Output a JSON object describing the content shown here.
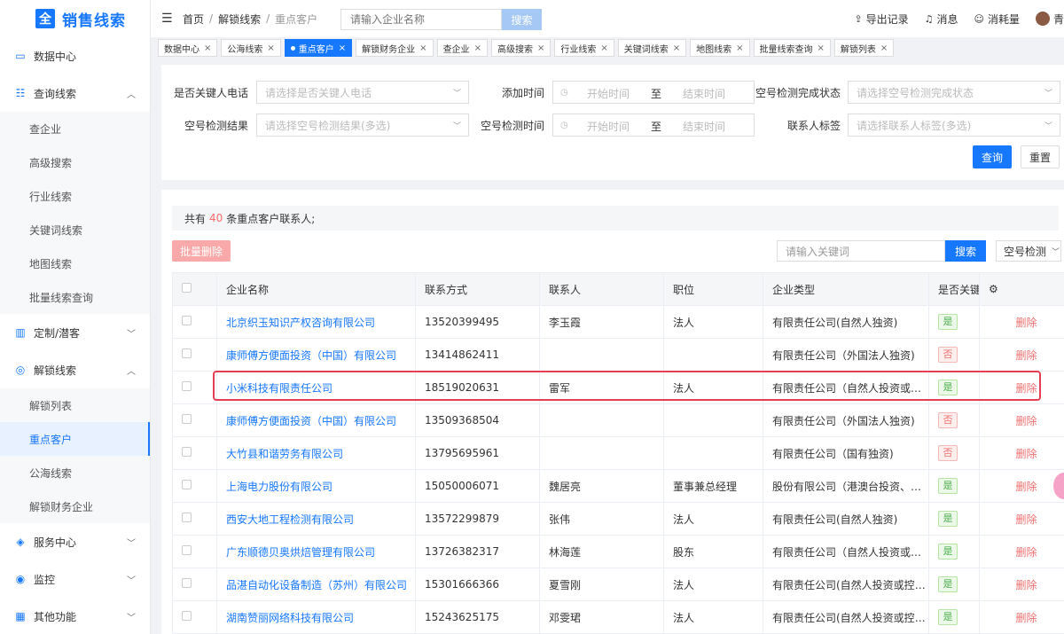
{
  "app": {
    "logo_mark": "全",
    "title": "销售线索"
  },
  "sidebar": {
    "items": [
      {
        "type": "group",
        "label": "数据中心",
        "icon": "monitor-icon",
        "glyph": "▭"
      },
      {
        "type": "group",
        "label": "查询线索",
        "icon": "search-list-icon",
        "glyph": "☷",
        "expanded": true
      },
      {
        "type": "sub",
        "label": "查企业"
      },
      {
        "type": "sub",
        "label": "高级搜索"
      },
      {
        "type": "sub",
        "label": "行业线索"
      },
      {
        "type": "sub",
        "label": "关键词线索"
      },
      {
        "type": "sub",
        "label": "地图线索"
      },
      {
        "type": "sub",
        "label": "批量线索查询"
      },
      {
        "type": "group",
        "label": "定制/潜客",
        "icon": "chart-icon",
        "glyph": "▥",
        "expanded": false
      },
      {
        "type": "group",
        "label": "解锁线索",
        "icon": "globe-icon",
        "glyph": "◎",
        "expanded": true
      },
      {
        "type": "sub",
        "label": "解锁列表"
      },
      {
        "type": "sub",
        "label": "重点客户",
        "active": true
      },
      {
        "type": "sub",
        "label": "公海线索"
      },
      {
        "type": "sub",
        "label": "解锁财务企业"
      },
      {
        "type": "group",
        "label": "服务中心",
        "icon": "cube-icon",
        "glyph": "◈",
        "expanded": false
      },
      {
        "type": "group",
        "label": "监控",
        "icon": "location-icon",
        "glyph": "◉",
        "expanded": false
      },
      {
        "type": "group",
        "label": "其他功能",
        "icon": "grid-icon",
        "glyph": "▦",
        "expanded": false
      }
    ]
  },
  "header": {
    "breadcrumb": [
      "首页",
      "解锁线索",
      "重点客户"
    ],
    "search_placeholder": "请输入企业名称",
    "search_button": "搜索",
    "export": "导出记录",
    "messages": "消息",
    "consumption": "消耗量",
    "user_initial": "青"
  },
  "tabs": [
    "数据中心",
    "公海线索",
    "重点客户",
    "解锁财务企业",
    "查企业",
    "高级搜索",
    "行业线索",
    "关键词线索",
    "地图线索",
    "批量线索查询",
    "解锁列表"
  ],
  "active_tab_index": 2,
  "filters": {
    "key_phone_label": "是否关键人电话",
    "key_phone_placeholder": "请选择是否关键人电话",
    "add_time_label": "添加时间",
    "check_status_label": "空号检测完成状态",
    "check_status_placeholder": "请选择空号检测完成状态",
    "check_result_label": "空号检测结果",
    "check_result_placeholder": "请选择空号检测结果(多选)",
    "check_time_label": "空号检测时间",
    "contact_tag_label": "联系人标签",
    "contact_tag_placeholder": "请选择联系人标签(多选)",
    "start_placeholder": "开始时间",
    "to": "至",
    "end_placeholder": "结束时间",
    "query_button": "查询",
    "reset_button": "重置"
  },
  "summary": {
    "prefix": "共有",
    "count": "40",
    "suffix": "条重点客户联系人;"
  },
  "toolbar": {
    "batch_delete": "批量删除",
    "keyword_placeholder": "请输入关键词",
    "search_button": "搜索",
    "check_dropdown": "空号检测"
  },
  "table": {
    "headers": [
      "企业名称",
      "联系方式",
      "联系人",
      "职位",
      "企业类型",
      "是否关键人"
    ],
    "rows": [
      {
        "company": "北京织玉知识产权咨询有限公司",
        "phone": "13520399495",
        "contact": "李玉霞",
        "position": "法人",
        "type": "有限责任公司(自然人独资)",
        "key": "是",
        "key_yes": true,
        "op": "删除"
      },
      {
        "company": "康师傅方便面投资（中国）有限公司",
        "phone": "13414862411",
        "contact": "",
        "position": "",
        "type": "有限责任公司（外国法人独资)",
        "key": "否",
        "key_yes": false,
        "op": "删除"
      },
      {
        "company": "小米科技有限责任公司",
        "phone": "18519020631",
        "contact": "雷军",
        "position": "法人",
        "type": "有限责任公司（自然人投资或控…",
        "key": "是",
        "key_yes": true,
        "op": "删除"
      },
      {
        "company": "康师傅方便面投资（中国）有限公司",
        "phone": "13509368504",
        "contact": "",
        "position": "",
        "type": "有限责任公司（外国法人独资)",
        "key": "否",
        "key_yes": false,
        "op": "删除"
      },
      {
        "company": "大竹县和谐劳务有限公司",
        "phone": "13795695961",
        "contact": "",
        "position": "",
        "type": "有限责任公司（国有独资)",
        "key": "否",
        "key_yes": false,
        "op": "删除"
      },
      {
        "company": "上海电力股份有限公司",
        "phone": "15050006071",
        "contact": "魏居亮",
        "position": "董事兼总经理",
        "type": "股份有限公司（港澳台投资、上…",
        "key": "是",
        "key_yes": true,
        "op": "删除"
      },
      {
        "company": "西安大地工程检测有限公司",
        "phone": "13572299879",
        "contact": "张伟",
        "position": "法人",
        "type": "有限责任公司(自然人独资)",
        "key": "是",
        "key_yes": true,
        "op": "删除"
      },
      {
        "company": "广东顺德贝奥烘焙管理有限公司",
        "phone": "13726382317",
        "contact": "林海莲",
        "position": "股东",
        "type": "有限责任公司（自然人投资或控…",
        "key": "是",
        "key_yes": true,
        "op": "删除"
      },
      {
        "company": "品湛自动化设备制造（苏州）有限公司",
        "phone": "15301666366",
        "contact": "夏雪刚",
        "position": "法人",
        "type": "有限责任公司(自然人投资或控股)",
        "key": "是",
        "key_yes": true,
        "op": "删除"
      },
      {
        "company": "湖南赞丽网络科技有限公司",
        "phone": "15243625175",
        "contact": "邓雯珺",
        "position": "法人",
        "type": "有限责任公司(自然人投资或控股)",
        "key": "是",
        "key_yes": true,
        "op": "删除"
      }
    ]
  },
  "colors": {
    "primary": "#1677ff",
    "danger": "#e53e54",
    "yes_tag": "#4caf50",
    "no_tag": "#f07070"
  }
}
